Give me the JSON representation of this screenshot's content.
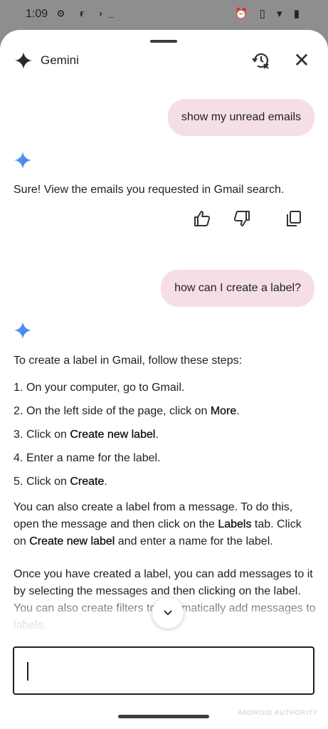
{
  "status_bar": {
    "time": "1:09",
    "left_icons": "⊙ ғ ›_",
    "right_icons": "⏰ ▯ ▾ ▮"
  },
  "header": {
    "title": "Gemini",
    "history_icon": "history-off-icon",
    "close_icon": "close-icon",
    "close_glyph": "✕"
  },
  "conversation": {
    "user_message_1": "show my unread emails",
    "reply_1": "Sure! View the emails you requested in Gmail search.",
    "user_message_2": "how can I create a label?",
    "reply_2": {
      "intro": "To create a label in Gmail, follow these steps:",
      "steps": [
        {
          "num": "1.",
          "text": "On your computer, go to Gmail."
        },
        {
          "num": "2.",
          "text": "On the left side of the page, click on ",
          "bold": "More",
          "after": "."
        },
        {
          "num": "3.",
          "text": "Click on ",
          "bold": "Create new label",
          "after": "."
        },
        {
          "num": "4.",
          "text": "Enter a name for the label."
        },
        {
          "num": "5.",
          "text": "Click on ",
          "bold": "Create",
          "after": "."
        }
      ],
      "para1_a": "You can also create a label from a message. To do this, open the message and then click on the ",
      "para1_b": "Labels",
      "para1_c": " tab. Click on ",
      "para1_d": "Create new label",
      "para1_e": " and enter a name for the label.",
      "para2": "Once you have created a label, you can add messages to it by selecting the messages and then clicking on the label. You can also create filters to automatically add messages to labels."
    }
  },
  "colors": {
    "bubble": "#f5dfe4",
    "gemini_star": "#4a8ef0"
  },
  "watermark": "ANDROID AUTHORITY"
}
